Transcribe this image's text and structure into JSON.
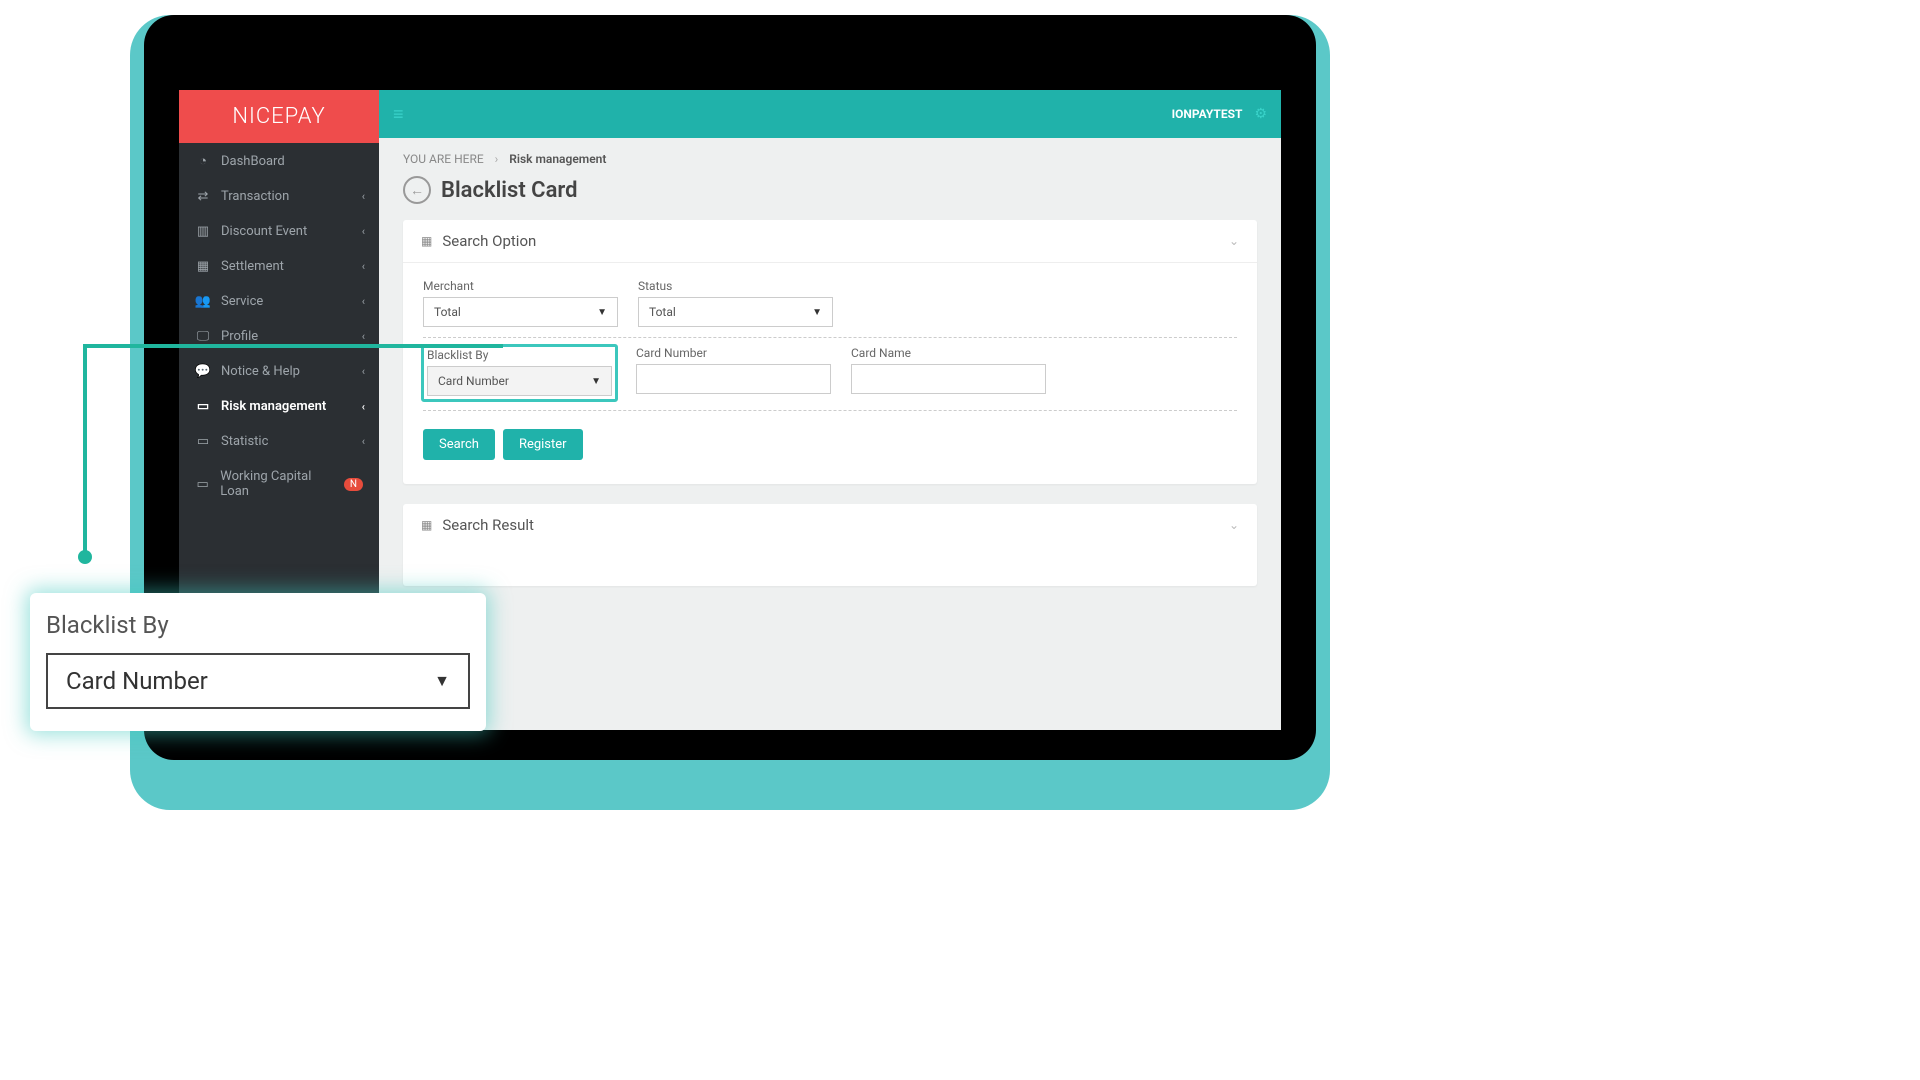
{
  "brand": "NICEPAY",
  "user": "IONPAYTEST",
  "breadcrumb": {
    "root": "YOU ARE HERE",
    "current": "Risk management"
  },
  "page_title": "Blacklist Card",
  "sidebar": {
    "items": [
      {
        "label": "DashBoard",
        "icon": "dashboard"
      },
      {
        "label": "Transaction",
        "icon": "transaction"
      },
      {
        "label": "Discount Event",
        "icon": "chart"
      },
      {
        "label": "Settlement",
        "icon": "calendar"
      },
      {
        "label": "Service",
        "icon": "users"
      },
      {
        "label": "Profile",
        "icon": "monitor"
      },
      {
        "label": "Notice & Help",
        "icon": "chat"
      },
      {
        "label": "Risk management",
        "icon": "folder",
        "active": true
      },
      {
        "label": "Statistic",
        "icon": "folder"
      },
      {
        "label": "Working Capital Loan",
        "icon": "folder",
        "badge": "N"
      }
    ]
  },
  "panels": {
    "search_option": "Search Option",
    "search_result": "Search Result"
  },
  "form": {
    "merchant": {
      "label": "Merchant",
      "value": "Total"
    },
    "status": {
      "label": "Status",
      "value": "Total"
    },
    "blacklist_by": {
      "label": "Blacklist By",
      "value": "Card Number"
    },
    "card_number": {
      "label": "Card Number",
      "value": ""
    },
    "card_name": {
      "label": "Card Name",
      "value": ""
    }
  },
  "buttons": {
    "search": "Search",
    "register": "Register"
  },
  "callout": {
    "label": "Blacklist By",
    "value": "Card Number"
  },
  "icons": {
    "dashboard": "⏱",
    "transaction": "⇄",
    "chart": "▥",
    "calendar": "▦",
    "users": "👥",
    "monitor": "🖵",
    "chat": "💬",
    "folder": "▭"
  }
}
